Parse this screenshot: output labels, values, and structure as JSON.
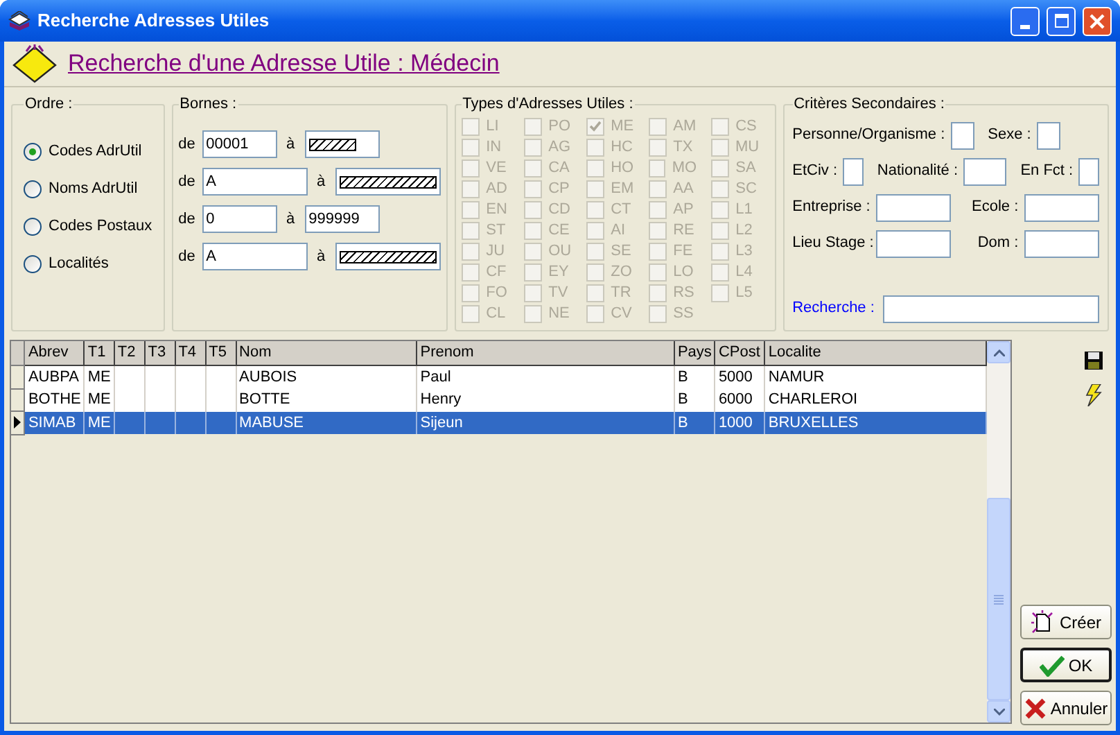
{
  "window": {
    "title": "Recherche Adresses Utiles"
  },
  "header": {
    "title": "Recherche d'une Adresse Utile : Médecin"
  },
  "ordre": {
    "label": "Ordre :",
    "options": [
      {
        "label": "Codes AdrUtil",
        "selected": true
      },
      {
        "label": "Noms AdrUtil",
        "selected": false
      },
      {
        "label": "Codes Postaux",
        "selected": false
      },
      {
        "label": "Localités",
        "selected": false
      }
    ]
  },
  "bornes": {
    "label": "Bornes :",
    "rows": [
      {
        "kind": "short",
        "from_label": "de",
        "from": "00001",
        "to_label": "à",
        "to": {
          "kind": "hatched"
        }
      },
      {
        "kind": "long",
        "from_label": "de",
        "from": "A",
        "to_label": "à",
        "to": {
          "kind": "hatched"
        }
      },
      {
        "kind": "short",
        "from_label": "de",
        "from": "0",
        "to_label": "à",
        "to": {
          "kind": "text",
          "value": "999999"
        }
      },
      {
        "kind": "long",
        "from_label": "de",
        "from": "A",
        "to_label": "à",
        "to": {
          "kind": "hatched"
        }
      }
    ]
  },
  "types": {
    "label": "Types d'Adresses Utiles :",
    "disabled": true,
    "columns": [
      [
        {
          "label": "LI",
          "checked": false
        },
        {
          "label": "IN",
          "checked": false
        },
        {
          "label": "VE",
          "checked": false
        },
        {
          "label": "AD",
          "checked": false
        },
        {
          "label": "EN",
          "checked": false
        },
        {
          "label": "ST",
          "checked": false
        },
        {
          "label": "JU",
          "checked": false
        },
        {
          "label": "CF",
          "checked": false
        },
        {
          "label": "FO",
          "checked": false
        },
        {
          "label": "CL",
          "checked": false
        }
      ],
      [
        {
          "label": "PO",
          "checked": false
        },
        {
          "label": "AG",
          "checked": false
        },
        {
          "label": "CA",
          "checked": false
        },
        {
          "label": "CP",
          "checked": false
        },
        {
          "label": "CD",
          "checked": false
        },
        {
          "label": "CE",
          "checked": false
        },
        {
          "label": "OU",
          "checked": false
        },
        {
          "label": "EY",
          "checked": false
        },
        {
          "label": "TV",
          "checked": false
        },
        {
          "label": "NE",
          "checked": false
        }
      ],
      [
        {
          "label": "ME",
          "checked": true
        },
        {
          "label": "HC",
          "checked": false
        },
        {
          "label": "HO",
          "checked": false
        },
        {
          "label": "EM",
          "checked": false
        },
        {
          "label": "CT",
          "checked": false
        },
        {
          "label": "AI",
          "checked": false
        },
        {
          "label": "SE",
          "checked": false
        },
        {
          "label": "ZO",
          "checked": false
        },
        {
          "label": "TR",
          "checked": false
        },
        {
          "label": "CV",
          "checked": false
        }
      ],
      [
        {
          "label": "AM",
          "checked": false
        },
        {
          "label": "TX",
          "checked": false
        },
        {
          "label": "MO",
          "checked": false
        },
        {
          "label": "AA",
          "checked": false
        },
        {
          "label": "AP",
          "checked": false
        },
        {
          "label": "RE",
          "checked": false
        },
        {
          "label": "FE",
          "checked": false
        },
        {
          "label": "LO",
          "checked": false
        },
        {
          "label": "RS",
          "checked": false
        },
        {
          "label": "SS",
          "checked": false
        }
      ],
      [
        {
          "label": "CS",
          "checked": false
        },
        {
          "label": "MU",
          "checked": false
        },
        {
          "label": "SA",
          "checked": false
        },
        {
          "label": "SC",
          "checked": false
        },
        {
          "label": "L1",
          "checked": false
        },
        {
          "label": "L2",
          "checked": false
        },
        {
          "label": "L3",
          "checked": false
        },
        {
          "label": "L4",
          "checked": false
        },
        {
          "label": "L5",
          "checked": false
        }
      ]
    ]
  },
  "criteres": {
    "label": "Critères Secondaires :",
    "rows": [
      [
        {
          "label": "Personne/Organisme :",
          "kind": "flag"
        },
        {
          "label": "Sexe :",
          "kind": "flag"
        }
      ],
      [
        {
          "label": "EtCiv :",
          "kind": "flag"
        },
        {
          "label": "Nationalité :",
          "kind": "code"
        },
        {
          "label": "En Fct :",
          "kind": "flag"
        }
      ],
      [
        {
          "label": "Entreprise :",
          "kind": "text"
        },
        {
          "label": "Ecole :",
          "kind": "text"
        }
      ],
      [
        {
          "label": "Lieu Stage :",
          "kind": "text"
        },
        {
          "label": "Dom :",
          "kind": "text"
        }
      ]
    ],
    "search": {
      "label": "Recherche :"
    }
  },
  "grid": {
    "columns": [
      "Abrev",
      "T1",
      "T2",
      "T3",
      "T4",
      "T5",
      "Nom",
      "Prenom",
      "Pays",
      "CPost",
      "Localite"
    ],
    "rows": [
      {
        "cells": [
          "AUBPA",
          "ME",
          "",
          "",
          "",
          "",
          "AUBOIS",
          "Paul",
          "B",
          "5000",
          "NAMUR"
        ],
        "selected": false
      },
      {
        "cells": [
          "BOTHE",
          "ME",
          "",
          "",
          "",
          "",
          "BOTTE",
          "Henry",
          "B",
          "6000",
          "CHARLEROI"
        ],
        "selected": false
      },
      {
        "cells": [
          "SIMAB",
          "ME",
          "",
          "",
          "",
          "",
          "MABUSE",
          "Sijeun",
          "B",
          "1000",
          "BRUXELLES"
        ],
        "selected": true
      }
    ]
  },
  "tools": [
    {
      "kind": "save"
    },
    {
      "kind": "run"
    }
  ],
  "actions": [
    {
      "kind": "create",
      "label": "Créer",
      "default": false
    },
    {
      "kind": "ok",
      "label": "OK",
      "default": true
    },
    {
      "kind": "cancel",
      "label": "Annuler",
      "default": false
    }
  ]
}
